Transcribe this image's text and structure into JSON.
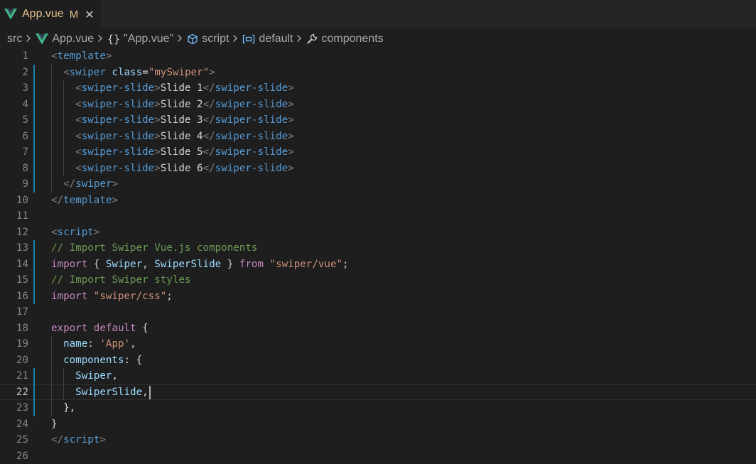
{
  "tab": {
    "title": "App.vue",
    "status": "M",
    "close_glyph": "✕",
    "logo_icon": "vue-logo-icon"
  },
  "breadcrumb": {
    "items": [
      {
        "label": "src",
        "icon": ""
      },
      {
        "label": "App.vue",
        "icon": "vue-logo-icon"
      },
      {
        "label": "\"App.vue\"",
        "icon": "braces-icon",
        "icon_text": "{}"
      },
      {
        "label": "script",
        "icon": "cube-icon"
      },
      {
        "label": "default",
        "icon": "field-icon"
      },
      {
        "label": "components",
        "icon": "wrench-icon"
      }
    ]
  },
  "colors": {
    "tag_punct": "#808080",
    "tag": "#569cd6",
    "attr": "#9cdcfe",
    "string": "#ce9178",
    "text": "#d4d4d4",
    "comment": "#6a9955",
    "keyword": "#c586c0",
    "variable": "#9cdcfe",
    "modified": "#1b81a8",
    "vue_green": "#41b883"
  },
  "editor": {
    "lines": [
      {
        "num": "1",
        "tokens": [
          [
            "tag_punct",
            "<"
          ],
          [
            "tag",
            "template"
          ],
          [
            "tag_punct",
            ">"
          ]
        ]
      },
      {
        "num": "2",
        "tokens": [
          [
            "text",
            "  "
          ],
          [
            "tag_punct",
            "<"
          ],
          [
            "tag",
            "swiper"
          ],
          [
            "text",
            " "
          ],
          [
            "attr",
            "class"
          ],
          [
            "text",
            "="
          ],
          [
            "string",
            "\"mySwiper\""
          ],
          [
            "tag_punct",
            ">"
          ]
        ]
      },
      {
        "num": "3",
        "tokens": [
          [
            "text",
            "    "
          ],
          [
            "tag_punct",
            "<"
          ],
          [
            "tag",
            "swiper-slide"
          ],
          [
            "tag_punct",
            ">"
          ],
          [
            "text",
            "Slide 1"
          ],
          [
            "tag_punct",
            "</"
          ],
          [
            "tag",
            "swiper-slide"
          ],
          [
            "tag_punct",
            ">"
          ]
        ]
      },
      {
        "num": "4",
        "tokens": [
          [
            "text",
            "    "
          ],
          [
            "tag_punct",
            "<"
          ],
          [
            "tag",
            "swiper-slide"
          ],
          [
            "tag_punct",
            ">"
          ],
          [
            "text",
            "Slide 2"
          ],
          [
            "tag_punct",
            "</"
          ],
          [
            "tag",
            "swiper-slide"
          ],
          [
            "tag_punct",
            ">"
          ]
        ]
      },
      {
        "num": "5",
        "tokens": [
          [
            "text",
            "    "
          ],
          [
            "tag_punct",
            "<"
          ],
          [
            "tag",
            "swiper-slide"
          ],
          [
            "tag_punct",
            ">"
          ],
          [
            "text",
            "Slide 3"
          ],
          [
            "tag_punct",
            "</"
          ],
          [
            "tag",
            "swiper-slide"
          ],
          [
            "tag_punct",
            ">"
          ]
        ]
      },
      {
        "num": "6",
        "tokens": [
          [
            "text",
            "    "
          ],
          [
            "tag_punct",
            "<"
          ],
          [
            "tag",
            "swiper-slide"
          ],
          [
            "tag_punct",
            ">"
          ],
          [
            "text",
            "Slide 4"
          ],
          [
            "tag_punct",
            "</"
          ],
          [
            "tag",
            "swiper-slide"
          ],
          [
            "tag_punct",
            ">"
          ]
        ]
      },
      {
        "num": "7",
        "tokens": [
          [
            "text",
            "    "
          ],
          [
            "tag_punct",
            "<"
          ],
          [
            "tag",
            "swiper-slide"
          ],
          [
            "tag_punct",
            ">"
          ],
          [
            "text",
            "Slide 5"
          ],
          [
            "tag_punct",
            "</"
          ],
          [
            "tag",
            "swiper-slide"
          ],
          [
            "tag_punct",
            ">"
          ]
        ]
      },
      {
        "num": "8",
        "tokens": [
          [
            "text",
            "    "
          ],
          [
            "tag_punct",
            "<"
          ],
          [
            "tag",
            "swiper-slide"
          ],
          [
            "tag_punct",
            ">"
          ],
          [
            "text",
            "Slide 6"
          ],
          [
            "tag_punct",
            "</"
          ],
          [
            "tag",
            "swiper-slide"
          ],
          [
            "tag_punct",
            ">"
          ]
        ]
      },
      {
        "num": "9",
        "tokens": [
          [
            "text",
            "  "
          ],
          [
            "tag_punct",
            "</"
          ],
          [
            "tag",
            "swiper"
          ],
          [
            "tag_punct",
            ">"
          ]
        ]
      },
      {
        "num": "10",
        "tokens": [
          [
            "tag_punct",
            "</"
          ],
          [
            "tag",
            "template"
          ],
          [
            "tag_punct",
            ">"
          ]
        ]
      },
      {
        "num": "11",
        "tokens": []
      },
      {
        "num": "12",
        "tokens": [
          [
            "tag_punct",
            "<"
          ],
          [
            "tag",
            "script"
          ],
          [
            "tag_punct",
            ">"
          ]
        ]
      },
      {
        "num": "13",
        "tokens": [
          [
            "comment",
            "// Import Swiper Vue.js components"
          ]
        ]
      },
      {
        "num": "14",
        "tokens": [
          [
            "keyword",
            "import"
          ],
          [
            "text",
            " { "
          ],
          [
            "variable",
            "Swiper"
          ],
          [
            "text",
            ", "
          ],
          [
            "variable",
            "SwiperSlide"
          ],
          [
            "text",
            " } "
          ],
          [
            "keyword",
            "from"
          ],
          [
            "text",
            " "
          ],
          [
            "string",
            "\"swiper/vue\""
          ],
          [
            "text",
            ";"
          ]
        ]
      },
      {
        "num": "15",
        "tokens": [
          [
            "comment",
            "// Import Swiper styles"
          ]
        ]
      },
      {
        "num": "16",
        "tokens": [
          [
            "keyword",
            "import"
          ],
          [
            "text",
            " "
          ],
          [
            "string",
            "\"swiper/css\""
          ],
          [
            "text",
            ";"
          ]
        ]
      },
      {
        "num": "17",
        "tokens": []
      },
      {
        "num": "18",
        "tokens": [
          [
            "keyword",
            "export"
          ],
          [
            "text",
            " "
          ],
          [
            "keyword",
            "default"
          ],
          [
            "text",
            " {"
          ]
        ]
      },
      {
        "num": "19",
        "tokens": [
          [
            "text",
            "  "
          ],
          [
            "variable",
            "name"
          ],
          [
            "text",
            ": "
          ],
          [
            "string",
            "'App'"
          ],
          [
            "text",
            ","
          ]
        ]
      },
      {
        "num": "20",
        "tokens": [
          [
            "text",
            "  "
          ],
          [
            "variable",
            "components"
          ],
          [
            "text",
            ": {"
          ]
        ]
      },
      {
        "num": "21",
        "tokens": [
          [
            "text",
            "    "
          ],
          [
            "variable",
            "Swiper"
          ],
          [
            "text",
            ","
          ]
        ]
      },
      {
        "num": "22",
        "tokens": [
          [
            "text",
            "    "
          ],
          [
            "variable",
            "SwiperSlide"
          ],
          [
            "text",
            ","
          ]
        ]
      },
      {
        "num": "23",
        "tokens": [
          [
            "text",
            "  },"
          ]
        ]
      },
      {
        "num": "24",
        "tokens": [
          [
            "text",
            "}"
          ]
        ]
      },
      {
        "num": "25",
        "tokens": [
          [
            "tag_punct",
            "</"
          ],
          [
            "tag",
            "script"
          ],
          [
            "tag_punct",
            ">"
          ]
        ]
      },
      {
        "num": "26",
        "tokens": []
      }
    ],
    "modified_lines": [
      2,
      3,
      4,
      5,
      6,
      7,
      8,
      9,
      13,
      14,
      15,
      16,
      21,
      22,
      23
    ],
    "current_line": 22
  }
}
